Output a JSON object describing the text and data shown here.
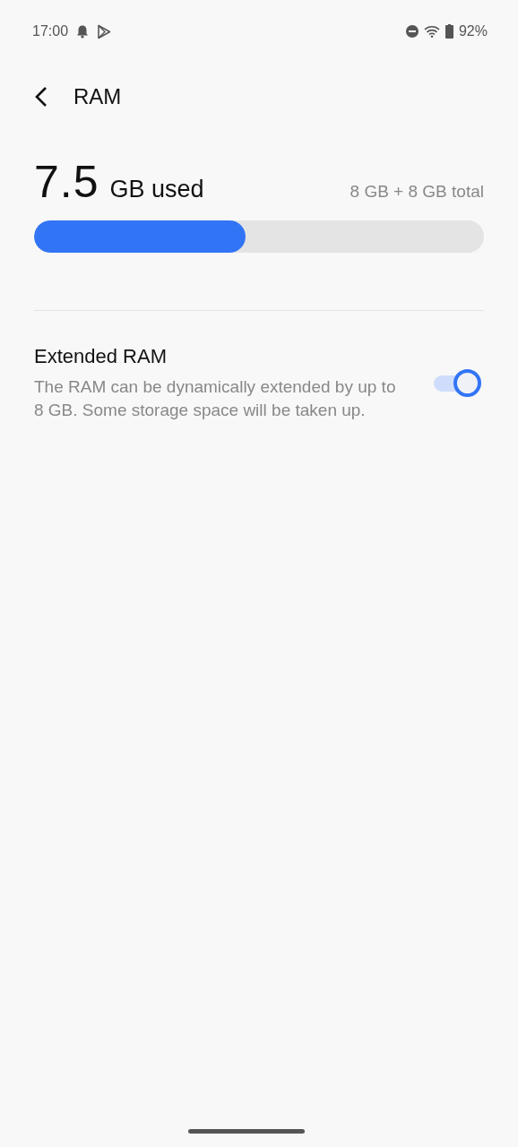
{
  "status_bar": {
    "time": "17:00",
    "battery": "92%"
  },
  "header": {
    "title": "RAM"
  },
  "usage": {
    "value": "7.5",
    "unit": "GB used",
    "total": "8 GB + 8 GB total",
    "level": 0.47
  },
  "setting": {
    "title": "Extended RAM",
    "description": "The RAM can be dynamically extended by up to 8 GB. Some storage space will be taken up.",
    "on": true
  }
}
